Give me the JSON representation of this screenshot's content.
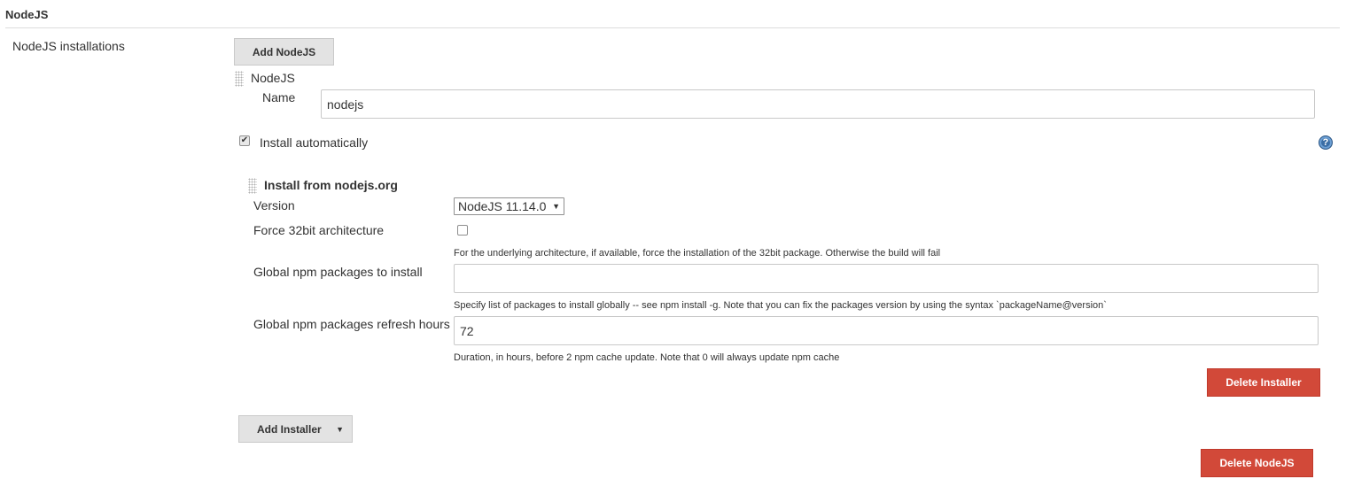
{
  "section": {
    "title": "NodeJS"
  },
  "installations": {
    "label": "NodeJS installations",
    "add_button": "Add NodeJS",
    "item_header": "NodeJS",
    "name_label": "Name",
    "name_value": "nodejs",
    "install_auto_label": "Install automatically",
    "install_auto_checked": true,
    "help_icon_glyph": "?",
    "delete_button": "Delete NodeJS"
  },
  "installer": {
    "title": "Install from nodejs.org",
    "version_label": "Version",
    "version_selected": "NodeJS 11.14.0",
    "version_arrow": "▼",
    "force32_label": "Force 32bit architecture",
    "force32_checked": false,
    "force32_help": "For the underlying architecture, if available, force the installation of the 32bit package. Otherwise the build will fail",
    "npm_packages_label": "Global npm packages to install",
    "npm_packages_value": "",
    "npm_packages_help": "Specify list of packages to install globally -- see npm install -g. Note that you can fix the packages version by using the syntax `packageName@version`",
    "refresh_label": "Global npm packages refresh hours",
    "refresh_value": "72",
    "refresh_help": "Duration, in hours, before 2 npm cache update. Note that 0 will always update npm cache",
    "delete_button": "Delete Installer"
  },
  "add_installer": {
    "label": "Add Installer",
    "arrow": "▼"
  },
  "colors": {
    "danger": "#d24939",
    "button_gray": "#e3e3e3",
    "help_blue": "#3b6ea5"
  }
}
